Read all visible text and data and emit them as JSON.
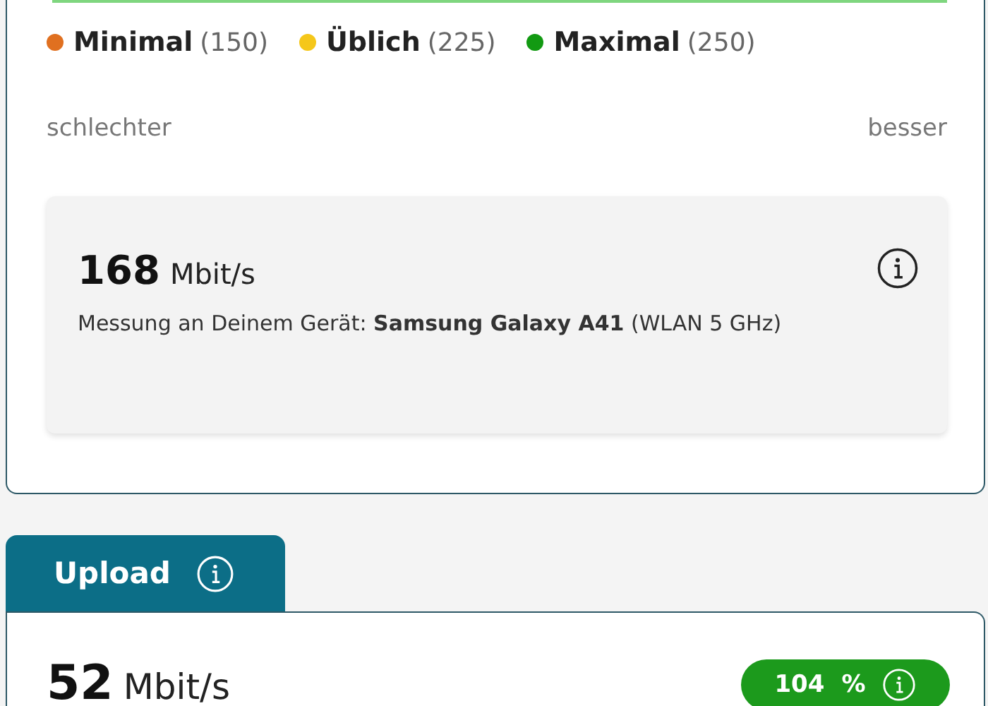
{
  "legend": [
    {
      "label": "Minimal",
      "value": "(150)",
      "color": "#e07020"
    },
    {
      "label": "Üblich",
      "value": "(225)",
      "color": "#f5c71a"
    },
    {
      "label": "Maximal",
      "value": "(250)",
      "color": "#129a12"
    }
  ],
  "scale": {
    "low": "schlechter",
    "high": "besser"
  },
  "measurement": {
    "speed": "168",
    "unit": "Mbit/s",
    "text": "Messung an Deinem Gerät: **Samsung Galaxy A41** (WLAN 5 GHz)"
  },
  "upload_tab": {
    "label": "Upload"
  },
  "upload": {
    "speed": "52",
    "unit": "Mbit/s",
    "percent": "104",
    "percent_sign": "%"
  }
}
